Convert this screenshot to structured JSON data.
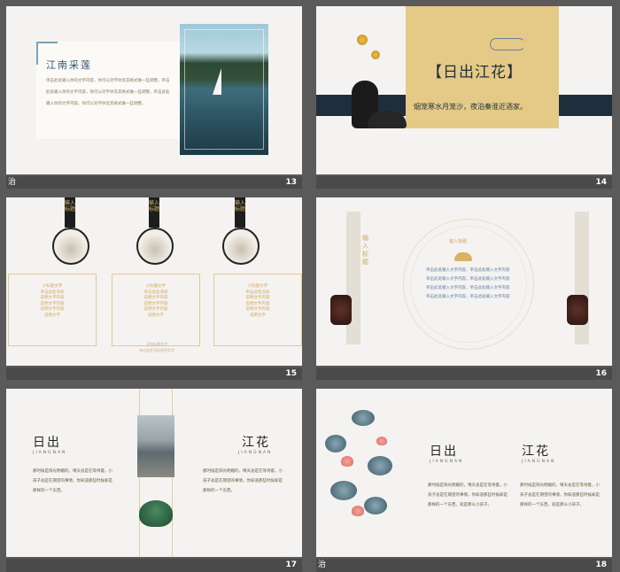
{
  "slides": [
    {
      "number": "13",
      "footer_left": "治"
    },
    {
      "number": "14"
    },
    {
      "number": "15"
    },
    {
      "number": "16"
    },
    {
      "number": "17"
    },
    {
      "number": "18",
      "footer_left": "治"
    }
  ],
  "s13": {
    "title": "江南采莲",
    "body": "单击此处输入你的文字内容，你可以对字体及其格式做一些调整，单击此处输入你的文字内容，你可以对字体及其格式做一些调整，单击此处输入你的文字内容，你可以对字体及其格式做一些调整。"
  },
  "s14": {
    "title": "【日出江花】",
    "subtitle": "烟笼寒水月笼沙，夜泊秦淮近酒家。"
  },
  "s15": {
    "tags": [
      "输入标题",
      "输入标题",
      "输入标题"
    ],
    "box_text": "小标题文字\n单击此处添加\n说明文字内容\n说明文字内容\n说明文字内容\n说明文字",
    "footer": "添加标题文字\n单击此处添加说明文字"
  },
  "s16": {
    "vertical_title": "输入标题",
    "circle_title": "输入标题",
    "lines": [
      "单击此处输入文字内容，单击此处输入文字内容",
      "单击此处输入文字内容，单击此处输入文字内容",
      "单击此处输入文字内容，单击此处输入文字内容",
      "单击此处输入文字内容，单击此处输入文字内容"
    ]
  },
  "s17": {
    "left_title": "日出",
    "left_en": "JIANGNAN",
    "right_title": "江花",
    "right_en": "JIANGNAN",
    "paragraph": "那时候是阳光明媚的，晴天总是在等待着，小孩子总是在期望的事情，你知道那些时候却是那样的一个东西。"
  },
  "s18": {
    "left_title": "日出",
    "left_en": "JIANGNAN",
    "right_title": "江花",
    "right_en": "JIANGNAN",
    "paragraph": "那时候是阳光明媚的，晴天总是在等待着，小孩子总是在期望的事情，你知道那些时候却是那样的一个东西，就是那么小孩子。"
  }
}
